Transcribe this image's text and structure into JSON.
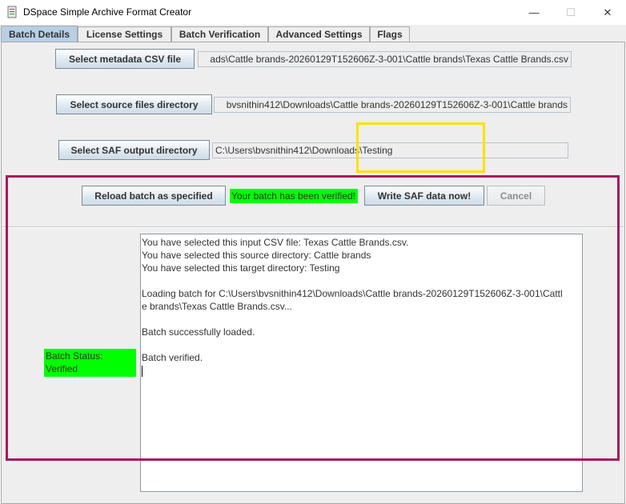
{
  "window": {
    "title": "DSpace Simple Archive Format Creator",
    "icon": "dspace-app-icon",
    "controls": {
      "minimize": "—",
      "maximize": "☐",
      "close": "✕"
    }
  },
  "tabs": [
    {
      "label": "Batch Details",
      "active": true
    },
    {
      "label": "License Settings",
      "active": false
    },
    {
      "label": "Batch Verification",
      "active": false
    },
    {
      "label": "Advanced Settings",
      "active": false
    },
    {
      "label": "Flags",
      "active": false
    }
  ],
  "batch": {
    "csv_button": "Select metadata CSV file",
    "csv_path": "ads\\Cattle brands-20260129T152606Z-3-001\\Cattle brands\\Texas Cattle Brands.csv",
    "source_button": "Select source files directory",
    "source_path": "bvsnithin412\\Downloads\\Cattle brands-20260129T152606Z-3-001\\Cattle brands",
    "output_button": "Select SAF output directory",
    "output_path": "C:\\Users\\bvsnithin412\\Downloads\\Testing",
    "reload_button": "Reload batch as specified",
    "verified_message": "Your batch has been verified!",
    "write_button": "Write SAF data now!",
    "cancel_button": "Cancel"
  },
  "status": {
    "line1": "Batch Status:",
    "line2": "Verified"
  },
  "log": [
    "You have selected this input CSV file: Texas Cattle Brands.csv.",
    "You have selected this source directory: Cattle brands",
    "You have selected this target directory: Testing",
    "",
    "Loading batch for C:\\Users\\bvsnithin412\\Downloads\\Cattle brands-20260129T152606Z-3-001\\Cattl",
    "e brands\\Texas Cattle Brands.csv...",
    "",
    "Batch successfully loaded.",
    "",
    "Batch verified."
  ],
  "colors": {
    "verified_green": "#00ff00",
    "active_tab": "#b8cfe5",
    "highlight_yellow": "#ffe000",
    "highlight_magenta": "#a8185c"
  }
}
